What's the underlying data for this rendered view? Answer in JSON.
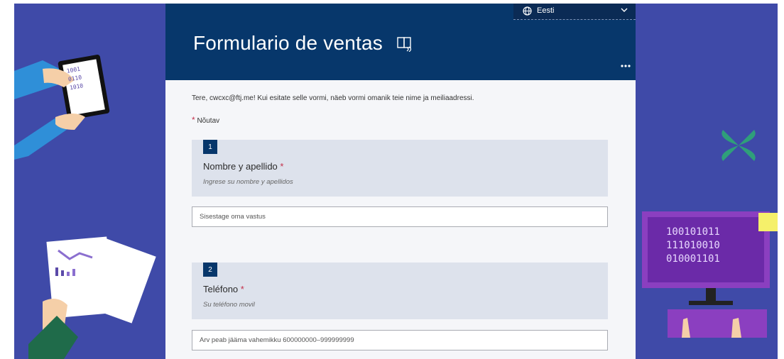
{
  "colors": {
    "background": "#3f4aa8",
    "header": "#07376b",
    "accent_required": "#c4314b",
    "question_bg": "#dde2ec"
  },
  "language": {
    "icon": "globe-icon",
    "selected": "Eesti",
    "chevron": "chevron-down-icon"
  },
  "form": {
    "title": "Formulario de ventas",
    "reader_icon": "immersive-reader-icon",
    "more_icon": "more-options-icon",
    "greeting": "Tere, cwcxc@ftj.me! Kui esitate selle vormi, näeb vormi omanik teie nime ja meiliaadressi.",
    "required_star": "*",
    "required_label": "Nõutav"
  },
  "questions": [
    {
      "number": "1",
      "title": "Nombre y apellido",
      "star": "*",
      "subtitle": "Ingrese su nombre y apellidos",
      "placeholder": "Sisestage oma vastus"
    },
    {
      "number": "2",
      "title": "Teléfono",
      "star": "*",
      "subtitle": "Su teléfono movil",
      "placeholder": "Arv peab jääma vahemikku 600000000–999999999"
    }
  ],
  "decor": {
    "tablet_bits": [
      "1001",
      "0110",
      "1010"
    ],
    "monitor_bits": [
      "100101011",
      "111010010",
      "010001101"
    ]
  }
}
